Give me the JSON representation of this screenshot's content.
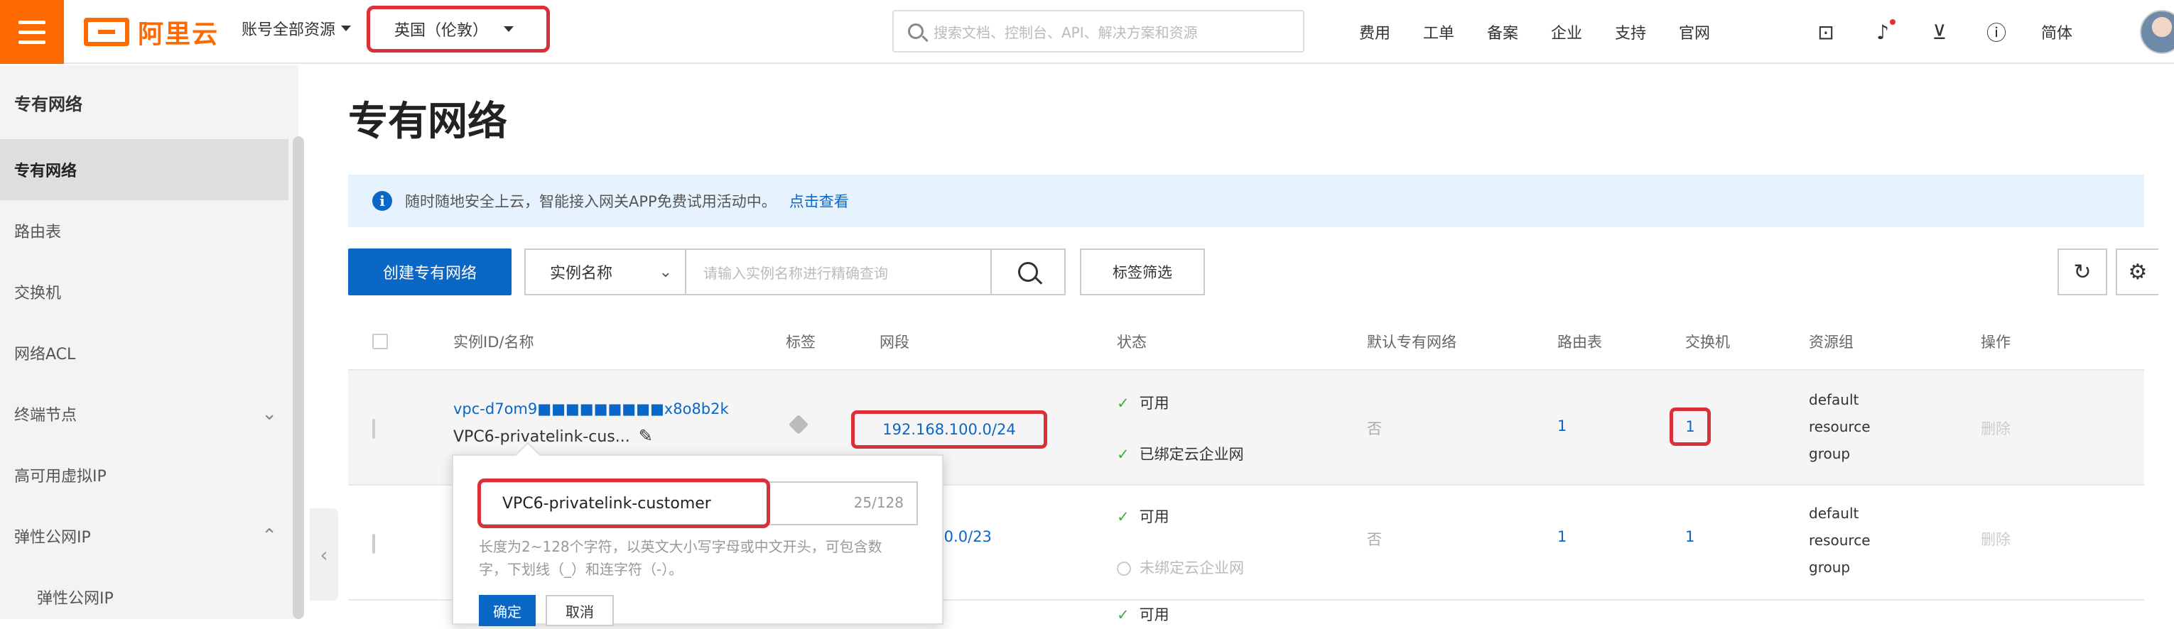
{
  "header": {
    "logo_text": "阿里云",
    "account_scope": "账号全部资源",
    "region": "英国（伦敦）",
    "search_placeholder": "搜索文档、控制台、API、解决方案和资源",
    "nav": [
      "费用",
      "工单",
      "备案",
      "企业",
      "支持",
      "官网"
    ],
    "icons": [
      "terminal-icon",
      "bell-icon",
      "cart-icon",
      "help-icon"
    ],
    "language": "简体"
  },
  "sidebar": {
    "title": "专有网络",
    "items": [
      {
        "label": "专有网络",
        "active": true
      },
      {
        "label": "路由表"
      },
      {
        "label": "交换机"
      },
      {
        "label": "网络ACL"
      },
      {
        "label": "终端节点",
        "chevron": "down"
      },
      {
        "label": "高可用虚拟IP"
      },
      {
        "label": "弹性公网IP",
        "chevron": "up"
      },
      {
        "label": "弹性公网IP",
        "sub": true
      }
    ]
  },
  "main": {
    "title": "专有网络",
    "notice": {
      "text": "随时随地安全上云，智能接入网关APP免费试用活动中。",
      "link": "点击查看"
    },
    "toolbar": {
      "create_label": "创建专有网络",
      "filter_select": "实例名称",
      "search_placeholder": "请输入实例名称进行精确查询",
      "tag_filter_label": "标签筛选"
    },
    "table": {
      "columns": [
        "实例ID/名称",
        "标签",
        "网段",
        "状态",
        "默认专有网络",
        "路由表",
        "交换机",
        "资源组",
        "操作"
      ],
      "rows": [
        {
          "id": "vpc-d7om9■■■■■■■■■x8o8b2k",
          "name": "VPC6-privatelink-cus...",
          "cidr": "192.168.100.0/24",
          "status": "可用",
          "cen_status": "已绑定云企业网",
          "default_vpc": "否",
          "route_tables": "1",
          "vswitches": "1",
          "resource_group": [
            "default",
            "resource",
            "group"
          ],
          "action": "删除"
        },
        {
          "cidr": ".0.0/23",
          "status": "可用",
          "cen_status": "未绑定云企业网",
          "default_vpc": "否",
          "route_tables": "1",
          "vswitches": "1",
          "resource_group": [
            "default",
            "resource",
            "group"
          ],
          "action": "删除"
        }
      ],
      "row3_status": "可用"
    },
    "edit_popover": {
      "value": "VPC6-privatelink-customer",
      "counter": "25/128",
      "hint": "长度为2~128个字符，以英文大小写字母或中文开头，可包含数字，下划线（_）和连字符（-）。",
      "ok_label": "确定",
      "cancel_label": "取消"
    }
  }
}
